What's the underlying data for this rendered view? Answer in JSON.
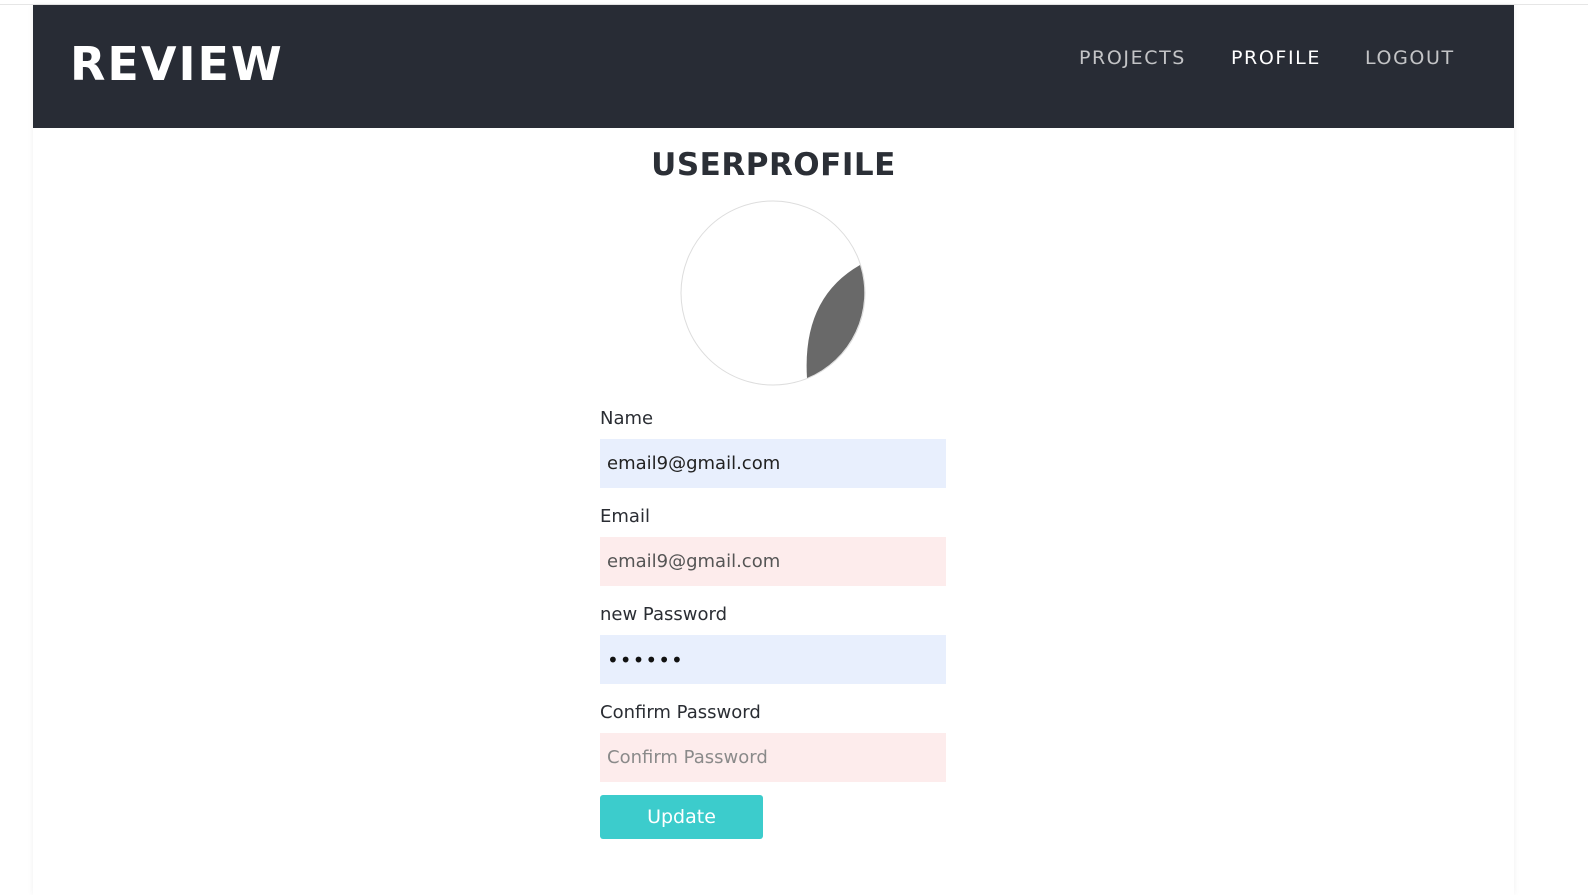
{
  "header": {
    "brand": "REVIEW",
    "nav": {
      "projects": "PROJECTS",
      "profile": "PROFILE",
      "logout": "LOGOUT"
    },
    "active": "profile"
  },
  "page_title": "USERPROFILE",
  "form": {
    "name": {
      "label": "Name",
      "value": "email9@gmail.com"
    },
    "email": {
      "label": "Email",
      "value": "email9@gmail.com"
    },
    "new_password": {
      "label": "new Password",
      "value": "••••••"
    },
    "confirm_password": {
      "label": "Confirm Password",
      "placeholder": "Confirm Password"
    },
    "submit_label": "Update"
  },
  "colors": {
    "navbar_bg": "#282c35",
    "button_accent": "#3ccccc",
    "input_blue": "#e8effd",
    "input_pink": "#fdecec",
    "avatar_shape": "#696969"
  },
  "avatar": {
    "icon": "user-avatar-placeholder-icon"
  }
}
